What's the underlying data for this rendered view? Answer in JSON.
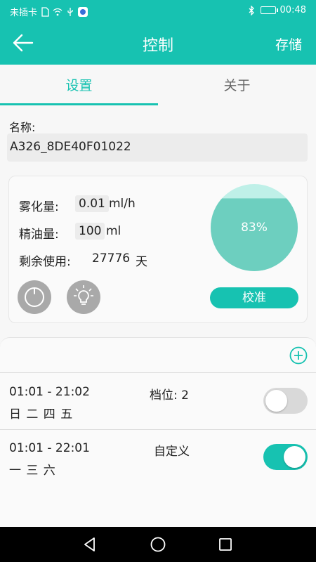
{
  "status_bar": {
    "carrier": "未插卡",
    "time": "00:48",
    "icons": [
      "sim-icon",
      "wifi-icon",
      "usb-icon",
      "app-notification-icon",
      "bluetooth-icon",
      "battery-icon"
    ]
  },
  "app_bar": {
    "title": "控制",
    "save_label": "存储",
    "back_icon": "arrow-left-icon"
  },
  "tabs": [
    {
      "label": "设置",
      "active": true
    },
    {
      "label": "关于",
      "active": false
    }
  ],
  "name": {
    "label": "名称:",
    "value": "A326_8DE40F01022"
  },
  "device": {
    "atomization_label": "雾化量:",
    "atomization_value": "0.01",
    "atomization_unit": "ml/h",
    "oil_label": "精油量:",
    "oil_value": "100",
    "oil_unit": "ml",
    "remaining_label": "剩余使用:",
    "remaining_value": "27776",
    "remaining_unit": "天",
    "level_percent": 83,
    "level_text": "83%",
    "calibrate_label": "校准",
    "power_icon": "power-icon",
    "light_icon": "lightbulb-icon"
  },
  "schedules": [
    {
      "time": "01:01 - 21:02",
      "days": "日 二 四 五",
      "mode": "档位: 2",
      "enabled": false
    },
    {
      "time": "01:01 - 22:01",
      "days": "一 三 六",
      "mode": "自定义",
      "enabled": true
    }
  ],
  "nav": {
    "icons": [
      "nav-back-icon",
      "nav-home-icon",
      "nav-recents-icon"
    ]
  },
  "colors": {
    "accent": "#17c2b1",
    "gauge_fill": "#6dcfbf",
    "gauge_top": "#bff0e8",
    "toggle_off": "#d9d9d9",
    "icon_gray": "#a9a9a9"
  }
}
